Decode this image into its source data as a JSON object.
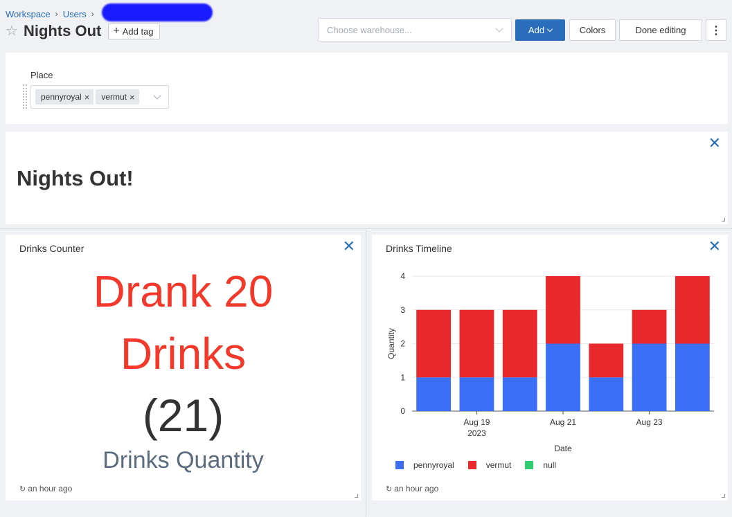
{
  "breadcrumb": {
    "workspace": "Workspace",
    "users": "Users"
  },
  "header": {
    "title": "Nights Out",
    "add_tag": "Add tag"
  },
  "toolbar": {
    "warehouse_placeholder": "Choose warehouse...",
    "add_label": "Add",
    "colors_label": "Colors",
    "done_label": "Done editing",
    "more_label": "⋮"
  },
  "filter": {
    "label": "Place",
    "chips": [
      "pennyroyal",
      "vermut"
    ]
  },
  "text_widget": {
    "title": "Nights Out!"
  },
  "counter": {
    "title": "Drinks Counter",
    "line1": "Drank 20",
    "line2": "Drinks",
    "line3": "(21)",
    "line4": "Drinks Quantity",
    "updated": "an hour ago",
    "colors": {
      "primary": "#f4392b",
      "secondary": "#5a6b7e"
    }
  },
  "timeline": {
    "title": "Drinks Timeline",
    "updated": "an hour ago"
  },
  "chart_data": {
    "type": "bar",
    "stacked": true,
    "categories": [
      "2023-08-18",
      "2023-08-19",
      "2023-08-20",
      "2023-08-21",
      "2023-08-22",
      "2023-08-23",
      "2023-08-24"
    ],
    "x_tick_labels": [
      {
        "index": 1,
        "label": "Aug 19",
        "sub": "2023"
      },
      {
        "index": 3,
        "label": "Aug 21",
        "sub": ""
      },
      {
        "index": 5,
        "label": "Aug 23",
        "sub": ""
      }
    ],
    "series": [
      {
        "name": "pennyroyal",
        "color": "#3b6ff7",
        "values": [
          1,
          1,
          1,
          2,
          1,
          2,
          2
        ]
      },
      {
        "name": "vermut",
        "color": "#e9292b",
        "values": [
          2,
          2,
          2,
          2,
          1,
          1,
          2
        ]
      },
      {
        "name": "null",
        "color": "#2ecc71",
        "values": [
          0,
          0,
          0,
          0,
          0,
          0,
          0
        ]
      }
    ],
    "xlabel": "Date",
    "ylabel": "Quantity",
    "ylim": [
      0,
      4
    ],
    "yticks": [
      0,
      1,
      2,
      3,
      4
    ],
    "grid": true,
    "legend": "bottom"
  }
}
